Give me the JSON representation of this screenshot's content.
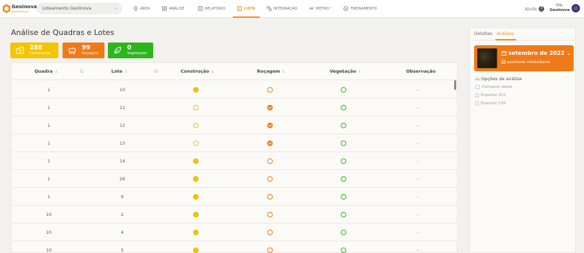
{
  "app": {
    "logo_name": "Geoinova",
    "logo_tagline": "geotecnologia",
    "project_select": "Loteamento Geolnova"
  },
  "nav": [
    {
      "label": "ÁREA",
      "icon": "pin-icon"
    },
    {
      "label": "ANÁLISE",
      "icon": "image-icon"
    },
    {
      "label": "RELATÓRIO",
      "icon": "report-icon"
    },
    {
      "label": "LISTA",
      "icon": "list-icon",
      "active": true
    },
    {
      "label": "INTEGRAÇÃO",
      "icon": "integration-icon"
    },
    {
      "label": "METRO ²",
      "icon": "ruler-icon"
    },
    {
      "label": "TREINAMENTO",
      "icon": "training-icon"
    }
  ],
  "header_right": {
    "help": "Ajuda",
    "help_icon": "?",
    "greeting": "Olá,",
    "user": "Geolnova"
  },
  "page": {
    "title": "Análise de Quadras e Lotes"
  },
  "stats": {
    "construcoes": {
      "value": "288",
      "label": "Construções",
      "color": "#f5c400"
    },
    "rocagens": {
      "value": "99",
      "label": "Roçagens",
      "color": "#ef7a19"
    },
    "vegetacoes": {
      "value": "0",
      "label": "Vegetações",
      "color": "#2db51c"
    }
  },
  "table": {
    "headers": {
      "quadra": "Quadra",
      "lote": "Lote",
      "construcao": "Construção",
      "rocagem": "Roçagem",
      "vegetacao": "Vegetação",
      "observacao": "Observação"
    },
    "sort_symbol": "↕",
    "rows": [
      {
        "quadra": "1",
        "lote": "10",
        "construcao": "filled",
        "rocagem": "outline",
        "vegetacao": "outline",
        "observacao": "-"
      },
      {
        "quadra": "1",
        "lote": "11",
        "construcao": "outline",
        "rocagem": "filled",
        "vegetacao": "outline",
        "observacao": "-"
      },
      {
        "quadra": "1",
        "lote": "12",
        "construcao": "outline",
        "rocagem": "filled",
        "vegetacao": "outline",
        "observacao": "-"
      },
      {
        "quadra": "1",
        "lote": "13",
        "construcao": "outline",
        "rocagem": "filled",
        "vegetacao": "outline",
        "observacao": "-"
      },
      {
        "quadra": "1",
        "lote": "14",
        "construcao": "filled",
        "rocagem": "outline",
        "vegetacao": "outline",
        "observacao": "-"
      },
      {
        "quadra": "1",
        "lote": "26",
        "construcao": "filled",
        "rocagem": "outline",
        "vegetacao": "outline",
        "observacao": "-"
      },
      {
        "quadra": "1",
        "lote": "9",
        "construcao": "filled",
        "rocagem": "outline",
        "vegetacao": "outline",
        "observacao": "-"
      },
      {
        "quadra": "10",
        "lote": "2",
        "construcao": "filled",
        "rocagem": "outline",
        "vegetacao": "outline",
        "observacao": "-"
      },
      {
        "quadra": "10",
        "lote": "4",
        "construcao": "filled",
        "rocagem": "outline",
        "vegetacao": "outline",
        "observacao": "-"
      },
      {
        "quadra": "10",
        "lote": "5",
        "construcao": "filled",
        "rocagem": "outline",
        "vegetacao": "outline",
        "observacao": "-"
      }
    ]
  },
  "side_panel": {
    "tabs": [
      "Detalhes",
      "Análises"
    ],
    "active_tab": "Análises",
    "period": "setembro de 2022",
    "quality": "qualidade média/baixa",
    "section_title": "Opções de análise",
    "options": [
      "Comparar datas",
      "Exportar XLS",
      "Exportar CSV"
    ]
  }
}
